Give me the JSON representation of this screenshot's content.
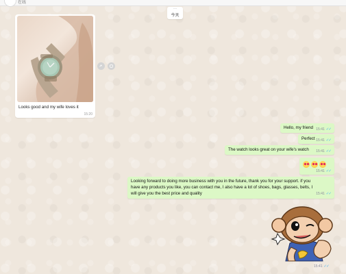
{
  "header": {
    "title": "在线"
  },
  "date_divider": {
    "top": "...",
    "label": "今天"
  },
  "incoming_message": {
    "caption": "Looks good and my wife loves it",
    "time": "15:20",
    "image_icon": "watch-photo"
  },
  "media_actions": {
    "share_icon": "share-icon",
    "react_icon": "emoji-icon"
  },
  "outgoing_messages": [
    {
      "text": "Hello, my friend",
      "time": "15:41"
    },
    {
      "text": "Perfect",
      "time": "15:41"
    },
    {
      "text": "The watch looks great on your wife's watch",
      "time": "15:41"
    },
    {
      "text": "",
      "time": "15:41"
    },
    {
      "text": "Looking forward to doing more business with you in the future, thank you for your support. if you have any products you like, you can contact me, I also have a lot of shoes, bags, glasses, belts, I will give you the best price and quality",
      "time": "15:41"
    }
  ],
  "sticker": {
    "time": "15:41",
    "description_icon": "monkey-sticker"
  },
  "colors": {
    "chat_background": "#efe7dd",
    "outgoing_bubble": "#dcf8c6",
    "incoming_bubble": "#ffffff",
    "read_ticks": "#4fb6ec"
  }
}
